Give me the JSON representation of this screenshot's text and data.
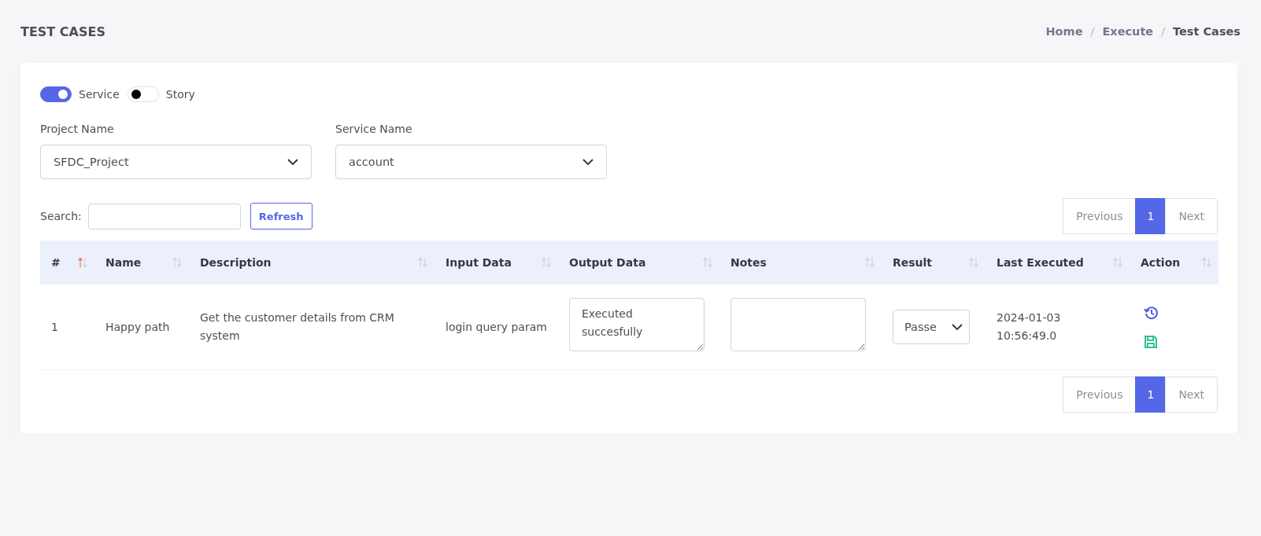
{
  "page_title": "TEST CASES",
  "breadcrumb": [
    {
      "kind": "link",
      "label": "Home"
    },
    {
      "kind": "separator",
      "label": "/"
    },
    {
      "kind": "link",
      "label": "Execute"
    },
    {
      "kind": "separator",
      "label": "/"
    },
    {
      "kind": "current",
      "label": "Test Cases"
    }
  ],
  "toggles": [
    {
      "label": "Service",
      "on": true
    },
    {
      "label": "Story",
      "on": false
    }
  ],
  "selects": [
    {
      "label": "Project Name",
      "value": "SFDC_Project"
    },
    {
      "label": "Service Name",
      "value": "account"
    }
  ],
  "search": {
    "label": "Search:"
  },
  "refresh_button": "Refresh",
  "pagination_top": [
    {
      "label": "Previous",
      "selected": false,
      "disabled": true
    },
    {
      "label": "1",
      "selected": true,
      "disabled": false
    },
    {
      "label": "Next",
      "selected": false,
      "disabled": true
    }
  ],
  "table": {
    "columns": [
      {
        "label": "#",
        "sorted": true
      },
      {
        "label": "Name",
        "sorted": false
      },
      {
        "label": "Description",
        "sorted": false
      },
      {
        "label": "Input Data",
        "sorted": false
      },
      {
        "label": "Output Data",
        "sorted": false
      },
      {
        "label": "Notes",
        "sorted": false
      },
      {
        "label": "Result",
        "sorted": false
      },
      {
        "label": "Last Executed",
        "sorted": false
      },
      {
        "label": "Action",
        "sorted": false
      }
    ],
    "rows": [
      {
        "number": "1",
        "name": "Happy path",
        "description": "Get the customer details from CRM system",
        "input_data": "login query param",
        "output_data": "Executed succesfully",
        "result": "Passe",
        "last_executed": "2024-01-03 10:56:49.0"
      }
    ]
  },
  "pagination_bottom": [
    {
      "label": "Previous",
      "selected": false,
      "disabled": true
    },
    {
      "label": "1",
      "selected": true,
      "disabled": false
    },
    {
      "label": "Next",
      "selected": false,
      "disabled": true
    }
  ]
}
